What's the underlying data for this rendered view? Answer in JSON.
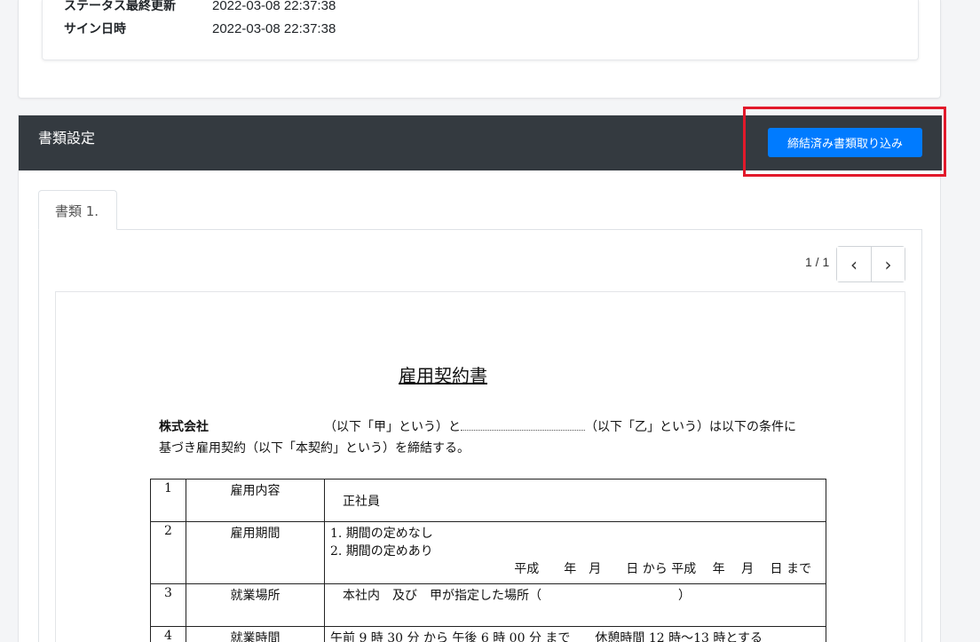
{
  "info": {
    "status_updated_label": "ステータス最終更新",
    "status_updated_value": "2022-03-08 22:37:38",
    "signed_label": "サイン日時",
    "signed_value": "2022-03-08 22:37:38"
  },
  "panel": {
    "title": "書類設定",
    "import_button": "締結済み書類取り込み"
  },
  "tabs": [
    {
      "label": "書類 1."
    }
  ],
  "pager": {
    "text": "1 / 1",
    "prev_icon": "chevron-left-icon",
    "next_icon": "chevron-right-icon"
  },
  "document": {
    "title": "雇用契約書",
    "company": "株式会社",
    "intro_1": "（以下「甲」という）と",
    "intro_2": "（以下「乙」という）は以下の条件に",
    "intro_line2": "基づき雇用契約（以下「本契約」という）を締結する。",
    "rows": [
      {
        "num": "1",
        "item": "雇用内容",
        "lines": [
          "正社員"
        ]
      },
      {
        "num": "2",
        "item": "雇用期間",
        "lines": [
          "1.  期間の定めなし",
          "2.   期間の定めあり",
          "平成　　年　月　　日 から 平成　 年　 月　 日 まで"
        ]
      },
      {
        "num": "3",
        "item": "就業場所",
        "lines": [
          "本社内　及び　甲が指定した場所（　　　　　　　　　　　）"
        ]
      },
      {
        "num": "4",
        "item": "就業時間",
        "lines": [
          "午前 9 時 30 分 から 午後 6 時 00 分 まで　　休憩時間 12 時～13 時とする"
        ]
      }
    ]
  },
  "colors": {
    "header_bg": "#343a40",
    "primary": "#007bff",
    "highlight": "#e2192b"
  }
}
